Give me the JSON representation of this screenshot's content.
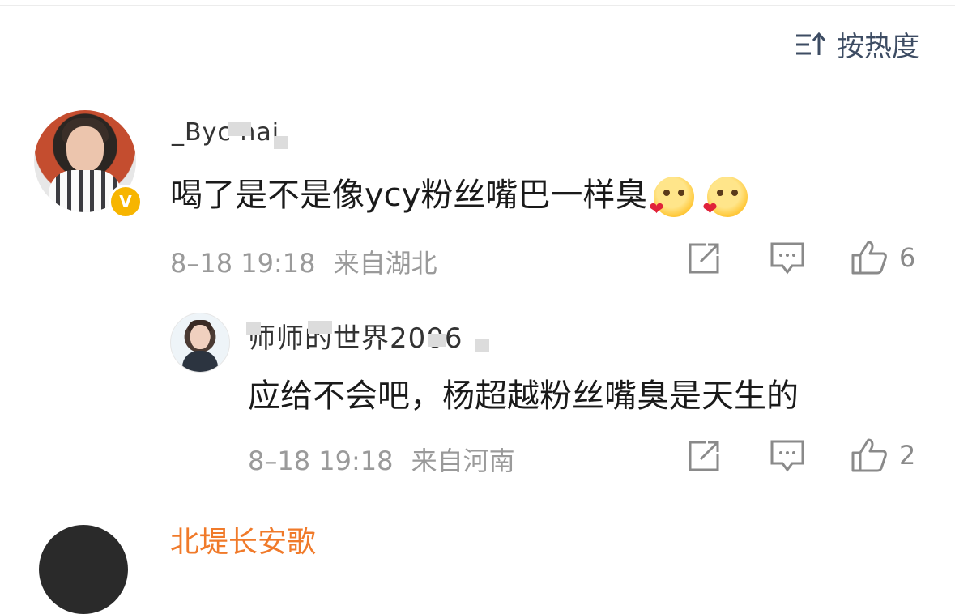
{
  "sort": {
    "label": "按热度",
    "icon": "sort-icon"
  },
  "comment": {
    "username": "_Byc hai",
    "text": "喝了是不是像ycy粉丝嘴巴一样臭",
    "emoji_count": 2,
    "timestamp": "8–18 19:18",
    "location": "来自湖北",
    "likes": "6",
    "verified_color": "#f7b500"
  },
  "reply": {
    "username": "师师的世界2006",
    "text": "应给不会吧，杨超越粉丝嘴臭是天生的",
    "timestamp": "8–18 19:18",
    "location": "来自河南",
    "likes": "2"
  },
  "next_comment": {
    "username": "北堤长安歌"
  },
  "colors": {
    "accent": "#3d4c63",
    "meta": "#9a9a9a",
    "name_highlight": "#f07a2a"
  }
}
